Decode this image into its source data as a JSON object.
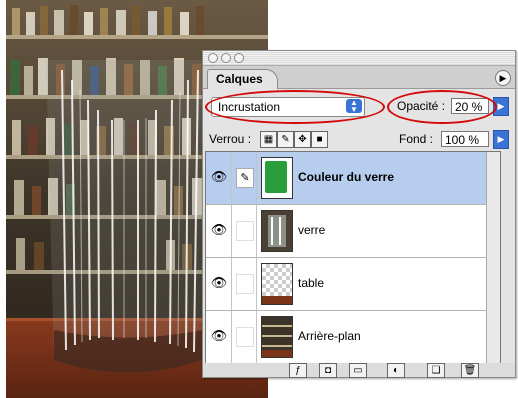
{
  "photo": {
    "description": "shelves-with-bottles-and-glass"
  },
  "palette": {
    "tab_label": "Calques",
    "blend_mode": "Incrustation",
    "opacity_label": "Opacité :",
    "opacity_value": "20 %",
    "lock_label": "Verrou :",
    "fill_label": "Fond :",
    "fill_value": "100 %",
    "layers": [
      {
        "name": "Couleur du verre",
        "selected": true,
        "bold": true,
        "thumb": "green-fill",
        "brush": true
      },
      {
        "name": "verre",
        "selected": false,
        "bold": false,
        "thumb": "glass",
        "brush": false
      },
      {
        "name": "table",
        "selected": false,
        "bold": false,
        "thumb": "table",
        "brush": false
      },
      {
        "name": "Arrière-plan",
        "selected": false,
        "bold": false,
        "thumb": "background",
        "brush": false
      }
    ]
  },
  "colors": {
    "selection": "#b7cdee",
    "accent_blue": "#3a73d6",
    "annotation_red": "#d30a0a",
    "layer_green": "#2a9e3a"
  }
}
